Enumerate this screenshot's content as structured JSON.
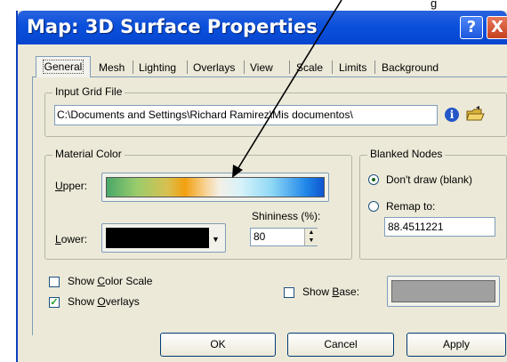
{
  "window": {
    "title": "Map: 3D Surface Properties",
    "help_glyph": "?",
    "close_glyph": "X"
  },
  "annotation": {
    "text": "g"
  },
  "tabs": [
    {
      "label": "General",
      "selected": true
    },
    {
      "label": "Mesh"
    },
    {
      "label": "Lighting"
    },
    {
      "label": "Overlays"
    },
    {
      "label": "View"
    },
    {
      "label": "Scale"
    },
    {
      "label": "Limits"
    },
    {
      "label": "Background"
    }
  ],
  "input_grid": {
    "legend": "Input Grid File",
    "path": "C:\\Documents and Settings\\Richard Ramirez\\Mis documentos\\"
  },
  "material_color": {
    "legend": "Material Color",
    "upper_label": "Upper:",
    "lower_label": "Lower:",
    "shininess_label": "Shininess (%):",
    "shininess_value": "80",
    "lower_color": "#000000"
  },
  "blanked_nodes": {
    "legend": "Blanked Nodes",
    "dont_draw_label": "Don't draw (blank)",
    "remap_label": "Remap to:",
    "remap_value": "88.4511221",
    "selected": "dont_draw"
  },
  "options": {
    "show_color_scale": "Show Color Scale",
    "show_color_scale_checked": false,
    "show_overlays": "Show Overlays",
    "show_overlays_checked": true,
    "show_base": "Show Base:",
    "show_base_checked": false,
    "base_color": "#a0a0a0"
  },
  "buttons": {
    "ok": "OK",
    "cancel": "Cancel",
    "apply": "Apply"
  }
}
